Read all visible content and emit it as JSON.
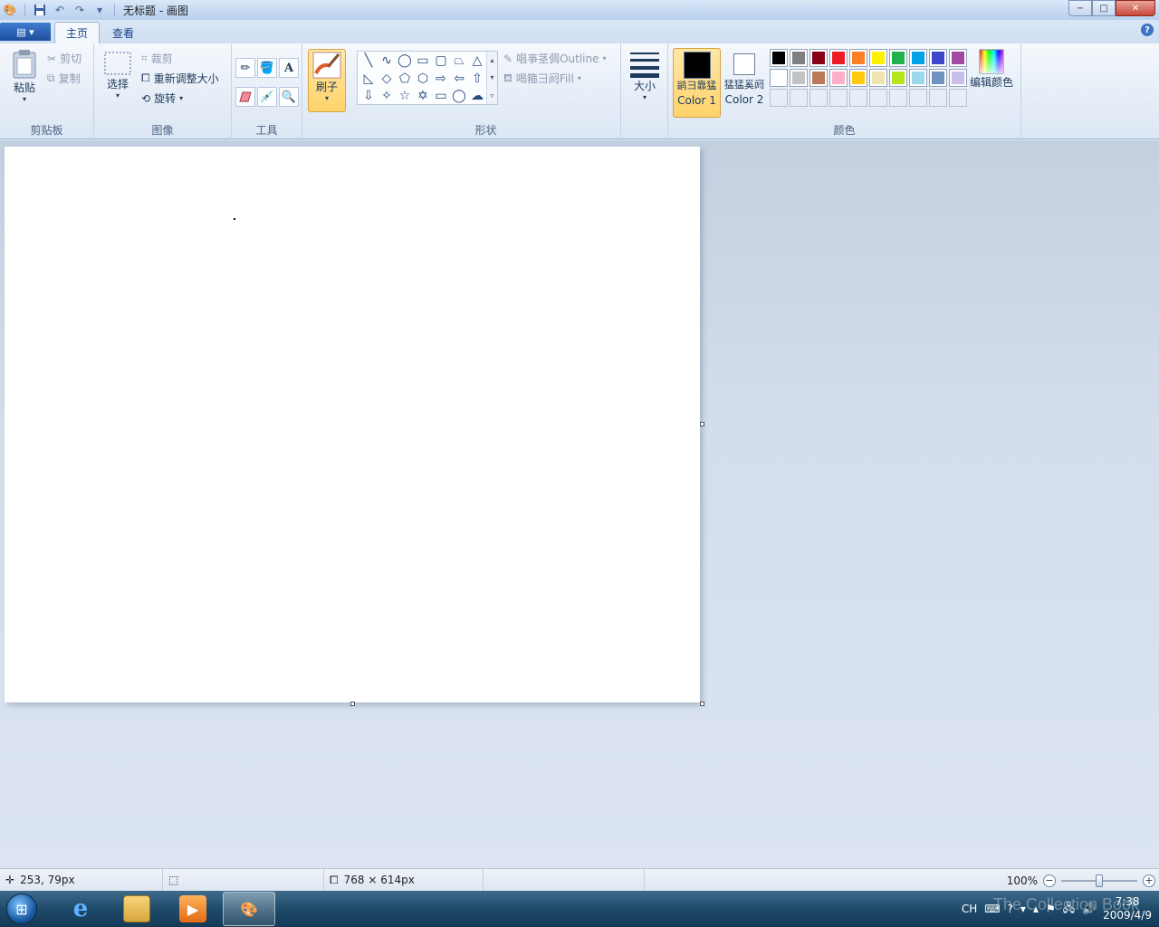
{
  "window": {
    "title": "无标题 - 画图",
    "controls": {
      "minimize": "−",
      "maximize": "□",
      "close": "✕"
    }
  },
  "quick_access": {
    "customize": "▾"
  },
  "ribbon_tabs": {
    "app_menu": "▤ ▾",
    "home": "主页",
    "view": "查看",
    "help": "?"
  },
  "clipboard": {
    "paste": "粘贴",
    "cut": "剪切",
    "copy": "复制",
    "label": "剪贴板"
  },
  "image": {
    "select": "选择",
    "crop": "裁剪",
    "resize": "重新调整大小",
    "rotate": "旋转",
    "label": "图像"
  },
  "tools": {
    "label": "工具",
    "text_glyph": "A"
  },
  "brushes": {
    "label": "刷子"
  },
  "shapes": {
    "outline": "唱亊茎倜Outline",
    "fill": "喝箍彐阏Fill",
    "label": "形状"
  },
  "size": {
    "label": "大小"
  },
  "colors": {
    "color1_cn": "鹟彐靠猛",
    "color1_en": "Color 1",
    "color2_cn": "猛猛奚阏",
    "color2_en": "Color 2",
    "edit_colors": "编辑颜色",
    "label": "颜色",
    "color1_value": "#000000",
    "color2_value": "#ffffff",
    "palette_row1": [
      "#000000",
      "#7f7f7f",
      "#880015",
      "#ed1c24",
      "#ff7f27",
      "#fff200",
      "#22b14c",
      "#00a2e8",
      "#3f48cc",
      "#a349a4"
    ],
    "palette_row2": [
      "#ffffff",
      "#c3c3c3",
      "#b97a57",
      "#ffaec9",
      "#ffc90e",
      "#efe4b0",
      "#b5e61d",
      "#99d9ea",
      "#7092be",
      "#c8bfe7"
    ]
  },
  "status": {
    "cursor_pos": "253, 79px",
    "canvas_size": "768 × 614px",
    "zoom": "100%",
    "zoom_level": 0.5
  },
  "taskbar": {
    "apps": [
      "internet-explorer",
      "windows-explorer",
      "media-player",
      "paint"
    ],
    "tray": {
      "lang": "CH",
      "time": "7:38",
      "date": "2009/4/9"
    },
    "watermark": "The Collection Book"
  }
}
